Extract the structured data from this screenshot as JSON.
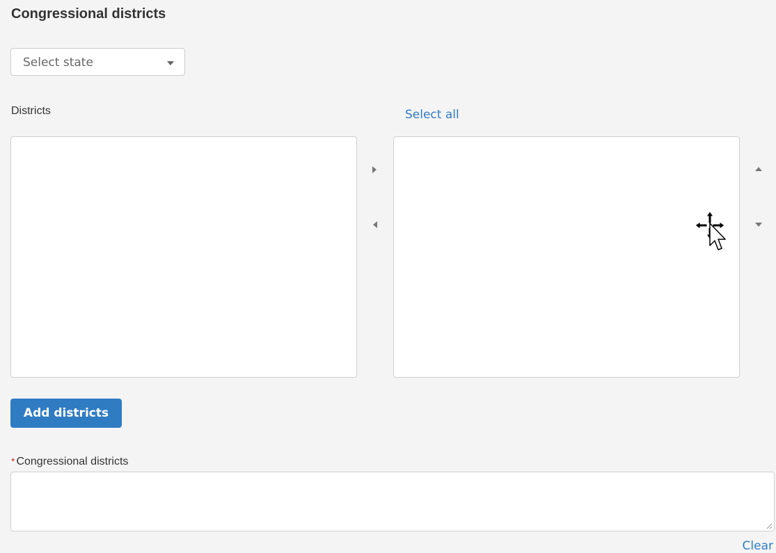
{
  "section": {
    "title": "Congressional districts"
  },
  "state_select": {
    "placeholder": "Select state",
    "icon": "chevron-down-icon"
  },
  "districts": {
    "label": "Districts",
    "select_all_label": "Select all"
  },
  "transfer_controls": {
    "move_right_icon": "arrow-right-icon",
    "move_left_icon": "arrow-left-icon",
    "move_up_icon": "arrow-up-icon",
    "move_down_icon": "arrow-down-icon"
  },
  "add_button": {
    "label": "Add districts"
  },
  "congressional_districts_field": {
    "required_marker": "*",
    "label": "Congressional districts",
    "value": ""
  },
  "clear_link": {
    "label": "Clear"
  },
  "colors": {
    "accent": "#2f7cc3",
    "background": "#f4f4f5",
    "required": "#c0392b"
  },
  "cursor": {
    "icon": "move-cursor-icon"
  }
}
